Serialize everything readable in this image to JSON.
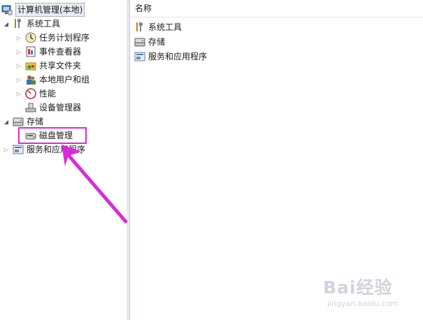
{
  "tree": {
    "root": {
      "label": "计算机管理(本地)",
      "icon": "computer-management-icon"
    },
    "system_tools": {
      "label": "系统工具",
      "icon": "tools-icon",
      "items": [
        {
          "label": "任务计划程序",
          "icon": "clock-icon"
        },
        {
          "label": "事件查看器",
          "icon": "event-viewer-icon"
        },
        {
          "label": "共享文件夹",
          "icon": "shared-folder-icon"
        },
        {
          "label": "本地用户和组",
          "icon": "users-icon"
        },
        {
          "label": "性能",
          "icon": "performance-icon"
        },
        {
          "label": "设备管理器",
          "icon": "device-manager-icon"
        }
      ]
    },
    "storage": {
      "label": "存储",
      "icon": "storage-icon",
      "child": {
        "label": "磁盘管理",
        "icon": "disk-icon"
      }
    },
    "services": {
      "label": "服务和应用程序",
      "icon": "services-icon"
    }
  },
  "list": {
    "column_header": "名称",
    "items": [
      {
        "label": "系统工具",
        "icon": "tools-icon"
      },
      {
        "label": "存储",
        "icon": "storage-icon"
      },
      {
        "label": "服务和应用程序",
        "icon": "services-icon"
      }
    ]
  },
  "annotation": {
    "color": "#d92ad9"
  },
  "watermark": {
    "main": "Bai经验",
    "sub": "jingyan.baidu.com"
  }
}
